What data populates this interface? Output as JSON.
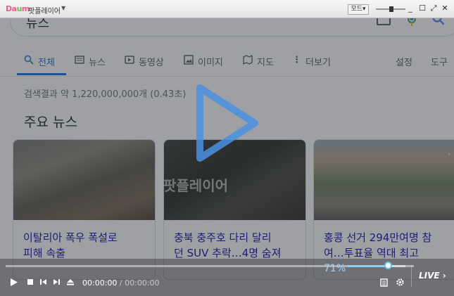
{
  "search": {
    "query": "뉴스"
  },
  "tabs": [
    {
      "label": "전체"
    },
    {
      "label": "뉴스"
    },
    {
      "label": "동영상"
    },
    {
      "label": "이미지"
    },
    {
      "label": "지도"
    },
    {
      "label": "더보기"
    },
    {
      "label": "설정"
    },
    {
      "label": "도구"
    }
  ],
  "results": {
    "stats": "검색결과 약 1,220,000,000개 (0.43초)",
    "section_title": "주요 뉴스"
  },
  "cards": [
    {
      "title_line1": "이탈리아 폭우 폭설로",
      "title_line2": "피해 속출"
    },
    {
      "title_line1": "충북 충주호 다리 달리",
      "title_line2": "던 SUV 추락…4명 숨져"
    },
    {
      "title_line1": "홍콩 선거 294만여명 참",
      "title_line2": "여…투표율 역대 최고"
    }
  ],
  "player": {
    "app_title": "팟플레이어",
    "mode_label": "모드",
    "watermark": "팟플레이어",
    "current_time": "00:00:00",
    "separator": "/",
    "total_time": "00:00:00",
    "volume_text": "71%",
    "volume": 0.71,
    "progress": 0,
    "live_label": "LIVE"
  },
  "colors": {
    "accent": "#1a73e8",
    "link": "#1a0dab",
    "player_accent": "#8fd0ff"
  }
}
